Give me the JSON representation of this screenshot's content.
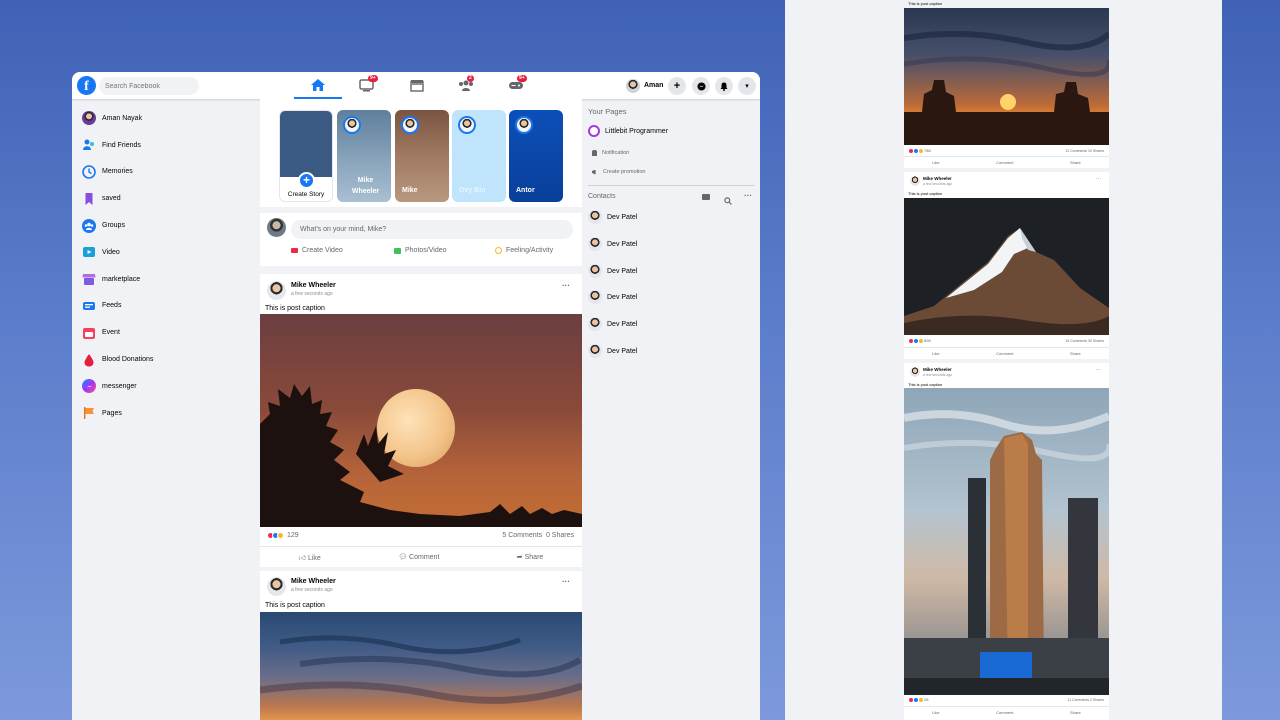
{
  "header": {
    "search_placeholder": "Search Facebook",
    "nav": [
      {
        "icon": "home-icon",
        "badge": ""
      },
      {
        "icon": "watch-icon",
        "badge": "9+"
      },
      {
        "icon": "marketplace-icon",
        "badge": ""
      },
      {
        "icon": "groups-icon",
        "badge": "2"
      },
      {
        "icon": "gaming-icon",
        "badge": "9+"
      }
    ],
    "profile_name": "Aman",
    "accent": "#1877f2"
  },
  "sidebar": {
    "items": [
      {
        "label": "Aman Nayak",
        "icon": "avatar-icon"
      },
      {
        "label": "Find Friends",
        "icon": "friends-icon"
      },
      {
        "label": "Memories",
        "icon": "memories-icon"
      },
      {
        "label": "saved",
        "icon": "saved-icon"
      },
      {
        "label": "Groups",
        "icon": "groups-icon"
      },
      {
        "label": "Video",
        "icon": "video-icon"
      },
      {
        "label": "marketplace",
        "icon": "marketplace-icon"
      },
      {
        "label": "Feeds",
        "icon": "feeds-icon"
      },
      {
        "label": "Event",
        "icon": "event-icon"
      },
      {
        "label": "Blood Donations",
        "icon": "blood-icon"
      },
      {
        "label": "messenger",
        "icon": "messenger-icon"
      },
      {
        "label": "Pages",
        "icon": "pages-icon"
      }
    ]
  },
  "stories": [
    {
      "name": "Create Story"
    },
    {
      "name": "Mike Wheeler"
    },
    {
      "name": "Mike"
    },
    {
      "name": "Ovy Bin"
    },
    {
      "name": "Antor"
    }
  ],
  "composer": {
    "placeholder": "What's on your mind, Mike?",
    "actions": [
      "Create Video",
      "Photos/Video",
      "Feeling/Activity"
    ]
  },
  "posts": [
    {
      "author": "Mike Wheeler",
      "time": "a few seconds ago",
      "caption": "This is post caption",
      "reactions": "129",
      "comments": "5 Comments",
      "shares": "0 Shares"
    },
    {
      "author": "Mike Wheeler",
      "time": "a few seconds ago",
      "caption": "This is post caption"
    }
  ],
  "post_actions": [
    "Like",
    "Comment",
    "Share"
  ],
  "right": {
    "your_pages_title": "Your Pages",
    "page_name": "Littlebit Programmer",
    "notification": "Notification",
    "create_promotion": "Create promotion",
    "contacts_title": "Contacts",
    "contacts": [
      "Dev Patel",
      "Dev Patel",
      "Dev Patel",
      "Dev Patel",
      "Dev Patel",
      "Dev Patel"
    ]
  },
  "mobile": {
    "top_caption": "This is post caption",
    "posts": [
      {
        "reactions": "786",
        "comments": "12 Comments",
        "shares": "10 Shares"
      },
      {
        "author": "Mike Wheeler",
        "time": "a few seconds ago",
        "caption": "This is post caption",
        "reactions": "896",
        "comments": "15 Comments",
        "shares": "30 Shares"
      },
      {
        "author": "Mike Wheeler",
        "time": "a few seconds ago",
        "caption": "This is post caption",
        "reactions": "28",
        "comments": "11 Comments",
        "shares": "2 Shares"
      }
    ]
  }
}
